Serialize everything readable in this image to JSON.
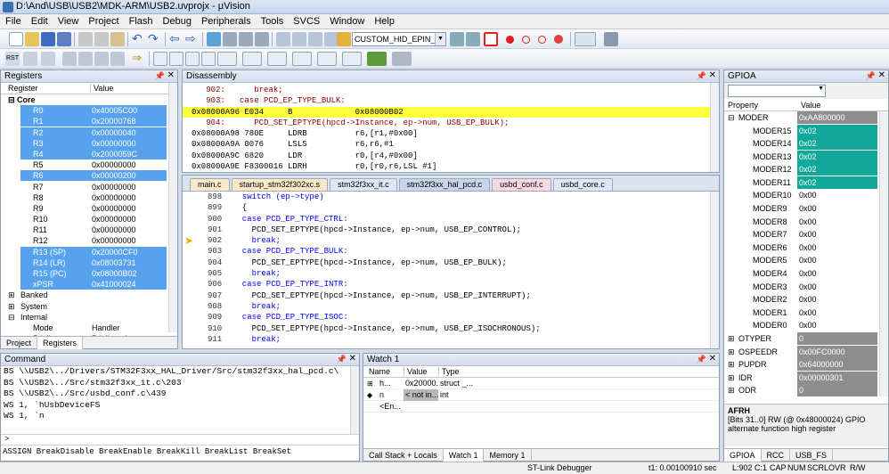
{
  "window": {
    "title": "D:\\And\\USB\\USB2\\MDK-ARM\\USB2.uvprojx - µVision"
  },
  "menu": [
    "File",
    "Edit",
    "View",
    "Project",
    "Flash",
    "Debug",
    "Peripherals",
    "Tools",
    "SVCS",
    "Window",
    "Help"
  ],
  "toolbar": {
    "target_combo": "CUSTOM_HID_EPIN_SIZE"
  },
  "registers": {
    "title": "Registers",
    "col_register": "Register",
    "col_value": "Value",
    "group": "Core",
    "rows": [
      {
        "name": "R0",
        "value": "0x40005C00",
        "sel": true
      },
      {
        "name": "R1",
        "value": "0x20000768",
        "sel": true
      },
      {
        "name": "R2",
        "value": "0x00000040",
        "sel": true
      },
      {
        "name": "R3",
        "value": "0x00000000",
        "sel": true
      },
      {
        "name": "R4",
        "value": "0x2000059C",
        "sel": true
      },
      {
        "name": "R5",
        "value": "0x00000000",
        "sel": false
      },
      {
        "name": "R6",
        "value": "0x00000200",
        "sel": true
      },
      {
        "name": "R7",
        "value": "0x00000000",
        "sel": false
      },
      {
        "name": "R8",
        "value": "0x00000000",
        "sel": false
      },
      {
        "name": "R9",
        "value": "0x00000000",
        "sel": false
      },
      {
        "name": "R10",
        "value": "0x00000000",
        "sel": false
      },
      {
        "name": "R11",
        "value": "0x00000000",
        "sel": false
      },
      {
        "name": "R12",
        "value": "0x00000000",
        "sel": false
      },
      {
        "name": "R13 (SP)",
        "value": "0x20000CF0",
        "sel": true
      },
      {
        "name": "R14 (LR)",
        "value": "0x08003731",
        "sel": true
      },
      {
        "name": "R15 (PC)",
        "value": "0x08000B02",
        "sel": true
      },
      {
        "name": "xPSR",
        "value": "0x41000024",
        "sel": true
      }
    ],
    "tree": [
      "Banked",
      "System",
      "Internal"
    ],
    "internal": [
      {
        "name": "Mode",
        "value": "Handler"
      },
      {
        "name": "Privilege",
        "value": "Privileged"
      }
    ],
    "tabs": [
      "Project",
      "Registers"
    ]
  },
  "disassembly": {
    "title": "Disassembly",
    "lines": [
      {
        "text": "   902:      break;",
        "type": "src"
      },
      {
        "text": "   903:   case PCD_EP_TYPE_BULK:",
        "type": "src"
      },
      {
        "text": "0x08000A96 E034     B             0x08000B02",
        "type": "cur"
      },
      {
        "text": "   904:      PCD_SET_EPTYPE(hpcd->Instance, ep->num, USB_EP_BULK);",
        "type": "src"
      },
      {
        "text": "0x08000A98 780E     LDRB          r6,[r1,#0x00]",
        "type": "asm"
      },
      {
        "text": "0x08000A9A 0076     LSLS          r6,r6,#1",
        "type": "asm"
      },
      {
        "text": "0x08000A9C 6820     LDR           r0,[r4,#0x00]",
        "type": "asm"
      },
      {
        "text": "0x08000A9E F8300016 LDRH          r0,[r0,r6,LSL #1]",
        "type": "asm"
      }
    ]
  },
  "editor": {
    "tabs": [
      "main.c",
      "startup_stm32f302xc.s",
      "stm32f3xx_it.c",
      "stm32f3xx_hal_pcd.c",
      "usbd_conf.c",
      "usbd_core.c"
    ],
    "active_tab": "stm32f3xx_hal_pcd.c",
    "lines": [
      {
        "n": "898",
        "code": "  switch (ep->type)"
      },
      {
        "n": "899",
        "code": "  {"
      },
      {
        "n": "900",
        "code": "  case PCD_EP_TYPE_CTRL:"
      },
      {
        "n": "901",
        "code": "    PCD_SET_EPTYPE(hpcd->Instance, ep->num, USB_EP_CONTROL);"
      },
      {
        "n": "902",
        "code": "    break;"
      },
      {
        "n": "903",
        "code": "  case PCD_EP_TYPE_BULK:"
      },
      {
        "n": "904",
        "code": "    PCD_SET_EPTYPE(hpcd->Instance, ep->num, USB_EP_BULK);"
      },
      {
        "n": "905",
        "code": "    break;"
      },
      {
        "n": "906",
        "code": "  case PCD_EP_TYPE_INTR:"
      },
      {
        "n": "907",
        "code": "    PCD_SET_EPTYPE(hpcd->Instance, ep->num, USB_EP_INTERRUPT);"
      },
      {
        "n": "908",
        "code": "    break;"
      },
      {
        "n": "909",
        "code": "  case PCD_EP_TYPE_ISOC:"
      },
      {
        "n": "910",
        "code": "    PCD_SET_EPTYPE(hpcd->Instance, ep->num, USB_EP_ISOCHRONOUS);"
      },
      {
        "n": "911",
        "code": "    break;"
      }
    ]
  },
  "gpioa": {
    "title": "GPIOA",
    "col_property": "Property",
    "col_value": "Value",
    "moder": {
      "name": "MODER",
      "value": "0xAA800000"
    },
    "fields": [
      {
        "name": "MODER15",
        "value": "0x02",
        "hl": true
      },
      {
        "name": "MODER14",
        "value": "0x02",
        "hl": true
      },
      {
        "name": "MODER13",
        "value": "0x02",
        "hl": true
      },
      {
        "name": "MODER12",
        "value": "0x02",
        "hl": true
      },
      {
        "name": "MODER11",
        "value": "0x02",
        "hl": true
      },
      {
        "name": "MODER10",
        "value": "0x00",
        "hl": false
      },
      {
        "name": "MODER9",
        "value": "0x00",
        "hl": false
      },
      {
        "name": "MODER8",
        "value": "0x00",
        "hl": false
      },
      {
        "name": "MODER7",
        "value": "0x00",
        "hl": false
      },
      {
        "name": "MODER6",
        "value": "0x00",
        "hl": false
      },
      {
        "name": "MODER5",
        "value": "0x00",
        "hl": false
      },
      {
        "name": "MODER4",
        "value": "0x00",
        "hl": false
      },
      {
        "name": "MODER3",
        "value": "0x00",
        "hl": false
      },
      {
        "name": "MODER2",
        "value": "0x00",
        "hl": false
      },
      {
        "name": "MODER1",
        "value": "0x00",
        "hl": false
      },
      {
        "name": "MODER0",
        "value": "0x00",
        "hl": false
      }
    ],
    "regs": [
      {
        "name": "OTYPER",
        "value": "0"
      },
      {
        "name": "OSPEEDR",
        "value": "0x00FC0000"
      },
      {
        "name": "PUPDR",
        "value": "0x64000000"
      },
      {
        "name": "IDR",
        "value": "0x00000301"
      },
      {
        "name": "ODR",
        "value": "0"
      }
    ],
    "desc_title": "AFRH",
    "desc_text": "[Bits 31..0] RW (@ 0x48000024) GPIO alternate function high  register",
    "tabs": [
      "GPIOA",
      "RCC",
      "USB_FS"
    ]
  },
  "command": {
    "title": "Command",
    "lines": [
      "BS \\\\USB2\\../Drivers/STM32F3xx_HAL_Driver/Src/stm32f3xx_hal_pcd.c\\",
      "BS \\\\USB2\\../Src/stm32f3xx_it.c\\203",
      "BS \\\\USB2\\../Src/usbd_conf.c\\439",
      "WS 1, `hUsbDeviceFS",
      "WS 1, `n"
    ],
    "prompt": ">",
    "help": "ASSIGN BreakDisable BreakEnable BreakKill BreakList BreakSet"
  },
  "watch": {
    "title": "Watch 1",
    "col_name": "Name",
    "col_value": "Value",
    "col_type": "Type",
    "rows": [
      {
        "name": "h...",
        "value": "0x20000...",
        "type": "struct _..."
      },
      {
        "name": "n",
        "value": "< not in...",
        "type": "int"
      },
      {
        "name": "<En...",
        "value": "",
        "type": ""
      }
    ],
    "tabs": [
      "Call Stack + Locals",
      "Watch 1",
      "Memory 1"
    ]
  },
  "status": {
    "debugger": "ST-Link Debugger",
    "time": "t1: 0.00100910 sec",
    "pos": "L:902 C:1",
    "flags": [
      "CAP",
      "NUM",
      "SCRL",
      "OVR",
      "R/W"
    ]
  },
  "colors": {
    "selection": "#56a2ef",
    "highlight": "#11a89a",
    "current_line": "#ffff40"
  }
}
